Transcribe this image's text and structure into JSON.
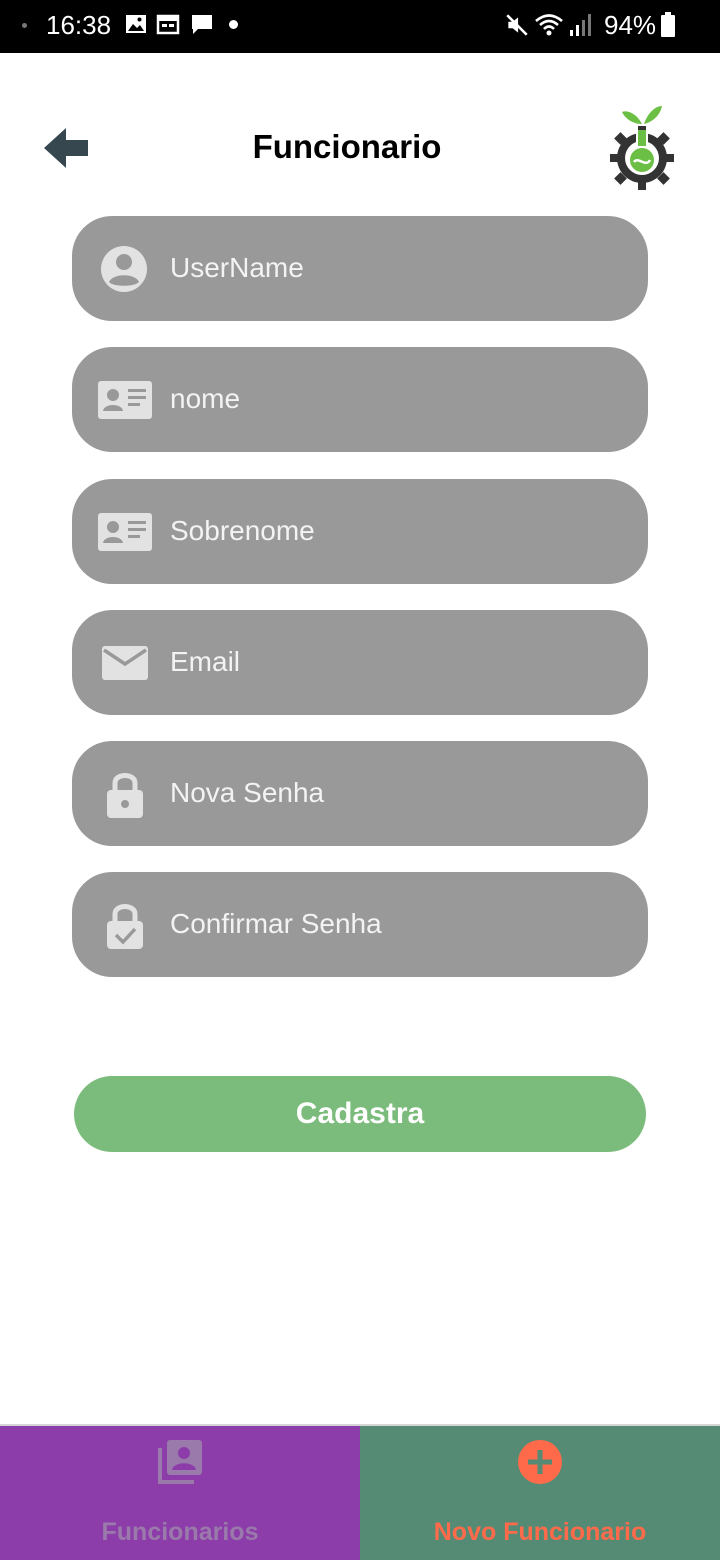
{
  "status_bar": {
    "time": "16:38",
    "battery": "94%",
    "icons": [
      "gallery-icon",
      "calendar-icon",
      "message-icon",
      "notification-dot",
      "mute-icon",
      "wifi-icon",
      "signal-icon",
      "battery-icon"
    ]
  },
  "header": {
    "title": "Funcionario",
    "back_icon": "arrow-back-icon",
    "logo": "gear-flask-logo"
  },
  "form": {
    "fields": [
      {
        "placeholder": "UserName",
        "icon": "account-circle-icon"
      },
      {
        "placeholder": "nome",
        "icon": "id-card-icon"
      },
      {
        "placeholder": "Sobrenome",
        "icon": "id-card-icon"
      },
      {
        "placeholder": "Email",
        "icon": "mail-icon"
      },
      {
        "placeholder": "Nova Senha",
        "icon": "lock-icon"
      },
      {
        "placeholder": "Confirmar Senha",
        "icon": "lock-check-icon"
      }
    ],
    "submit_label": "Cadastra"
  },
  "bottom_nav": {
    "items": [
      {
        "label": "Funcionarios",
        "icon": "contacts-list-icon",
        "active": false
      },
      {
        "label": "Novo Funcionario",
        "icon": "add-circle-icon",
        "active": true
      }
    ]
  },
  "colors": {
    "field_bg": "#999999",
    "field_text": "#f3f3f3",
    "button_bg": "#7bbb7b",
    "nav_left_bg": "#8c3da9",
    "nav_right_bg": "#558b75",
    "nav_active_text": "#ff6b4a",
    "logo_green": "#6cbf45",
    "logo_gear": "#333333"
  }
}
